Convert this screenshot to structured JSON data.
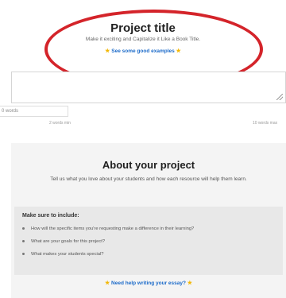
{
  "title_section": {
    "heading": "Project title",
    "subtitle": "Make it exciting and Capitalize it Like a Book Title.",
    "examples_link": "See some good examples",
    "star_glyph": "★"
  },
  "title_input": {
    "value": ""
  },
  "counter": {
    "word_count": "0 words",
    "min_label": "2 words min",
    "max_label": "10 words max"
  },
  "about_section": {
    "heading": "About your project",
    "description": "Tell us what you love about your students and how each resource will help them learn.",
    "include_heading": "Make sure to include:",
    "include_items": [
      "How will the specific items you're requesting make a difference in their learning?",
      "What are your goals for this project?",
      "What makes your students special?"
    ],
    "help_link": "Need help writing your essay?"
  },
  "colors": {
    "annotation_circle": "#d4242a",
    "link": "#1b6ac9",
    "star": "#f2b705"
  }
}
